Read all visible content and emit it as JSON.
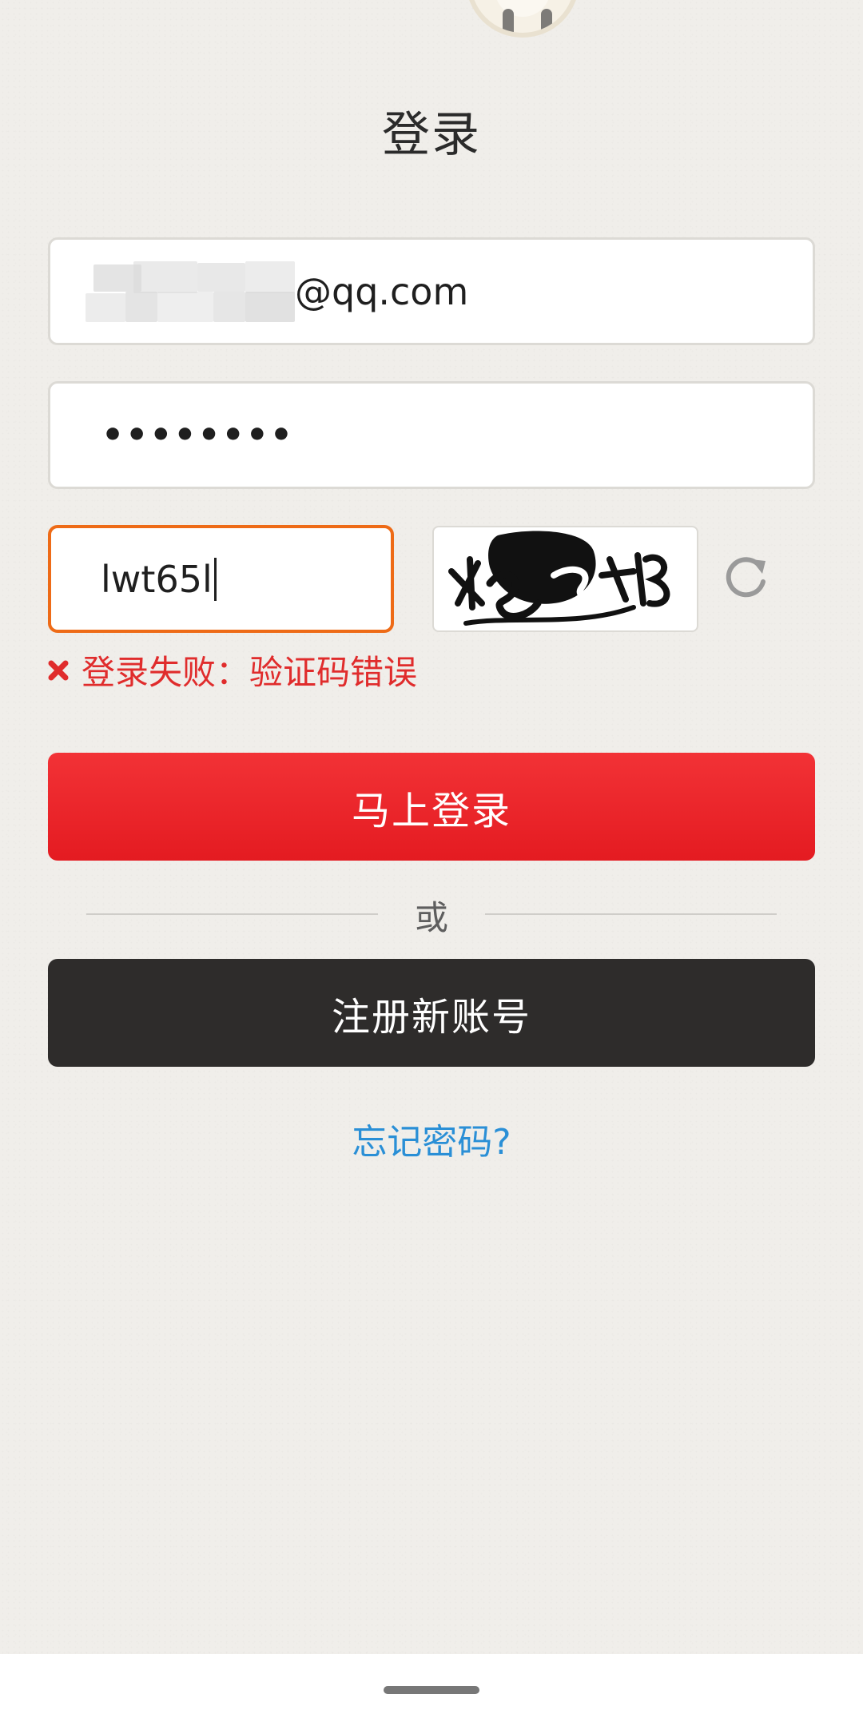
{
  "header": {
    "title": "登录"
  },
  "form": {
    "email_suffix": "@qq.com",
    "password_masked": "••••••••",
    "captcha_value": "lwt65l",
    "error_message": "登录失败：验证码错误"
  },
  "buttons": {
    "login_label": "马上登录",
    "divider_text": "或",
    "register_label": "注册新账号",
    "forgot_label": "忘记密码?"
  },
  "colors": {
    "login_button": "#e41b21",
    "register_button": "#2e2c2b",
    "error_text": "#e02c2c",
    "link": "#2a8fd6",
    "captcha_focus_border": "#ee6b17"
  },
  "icons": {
    "error": "close-x-icon",
    "refresh": "refresh-icon"
  }
}
